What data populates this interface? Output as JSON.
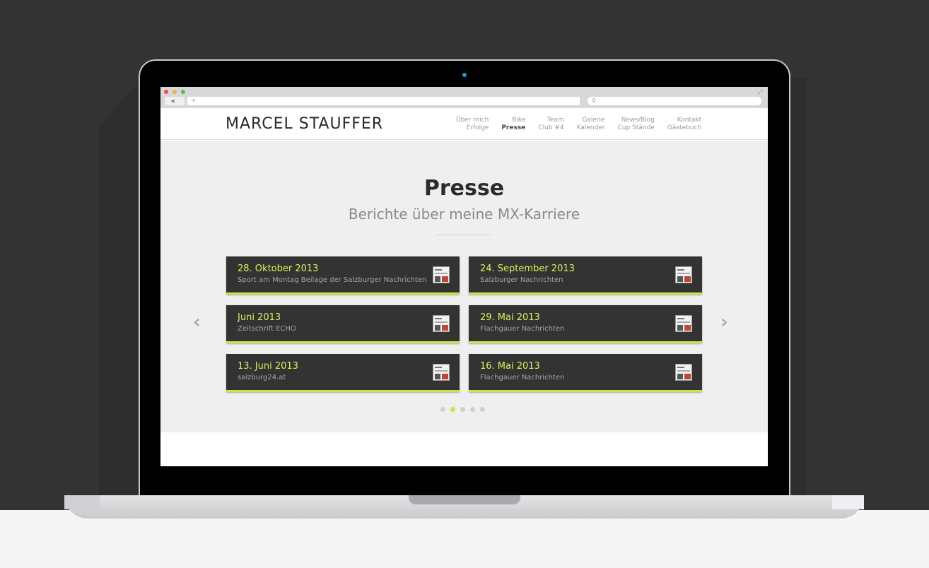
{
  "site": {
    "logo": "MARCEL STAUFFER"
  },
  "browser": {
    "url_plus": "+",
    "nav_arrows": "◀ ▶",
    "search_icon": "search-icon",
    "expand_icon": "expand-icon"
  },
  "menu": [
    {
      "top": "Über mich",
      "bottom": "Erfolge",
      "active": ""
    },
    {
      "top": "Bike",
      "bottom": "Presse",
      "active": "bottom"
    },
    {
      "top": "Team",
      "bottom": "Club #4",
      "active": ""
    },
    {
      "top": "Galerie",
      "bottom": "Kalender",
      "active": ""
    },
    {
      "top": "News/Blog",
      "bottom": "Cup Stände",
      "active": ""
    },
    {
      "top": "Kontakt",
      "bottom": "Gästebuch",
      "active": ""
    }
  ],
  "hero": {
    "title": "Presse",
    "subtitle": "Berichte über meine MX-Karriere"
  },
  "cards": [
    {
      "date": "28. Oktober 2013",
      "source": "Sport am Montag Beilage der Salzburger Nachrichten"
    },
    {
      "date": "24. September 2013",
      "source": "Salzburger Nachrichten"
    },
    {
      "date": "Juni 2013",
      "source": "Zeitschrift ECHO"
    },
    {
      "date": "29. Mai 2013",
      "source": "Flachgauer Nachrichten"
    },
    {
      "date": "13. Juni 2013",
      "source": "salzburg24.at"
    },
    {
      "date": "16. Mai 2013",
      "source": "Flachgauer Nachrichten"
    }
  ],
  "carousel": {
    "prev": "‹",
    "next": "›",
    "pages": 5,
    "active_page": 2
  },
  "colors": {
    "accent": "#c7e64a",
    "card_bg": "#333333",
    "page_bg": "#efefef"
  }
}
